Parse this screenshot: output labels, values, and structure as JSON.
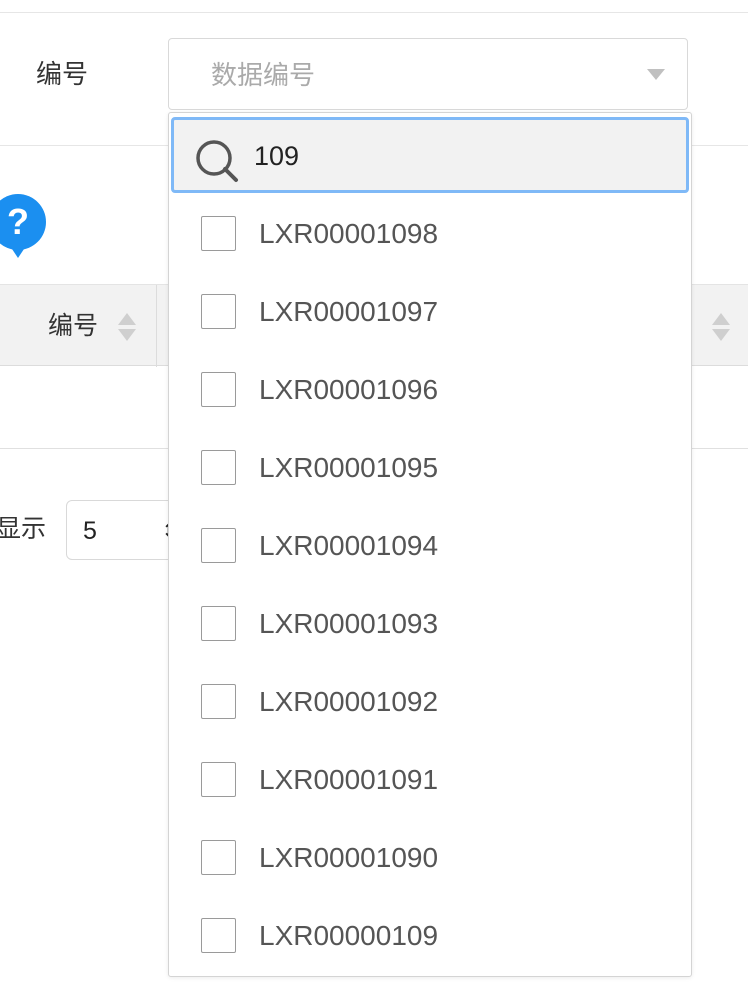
{
  "form": {
    "code_label": "编号",
    "select_placeholder": "数据编号"
  },
  "table": {
    "header_code": "编号"
  },
  "pagination": {
    "show_label": "显示",
    "page_size": "5"
  },
  "dropdown": {
    "search_value": "109",
    "options": [
      {
        "label": "LXR00001098",
        "checked": false
      },
      {
        "label": "LXR00001097",
        "checked": false
      },
      {
        "label": "LXR00001096",
        "checked": false
      },
      {
        "label": "LXR00001095",
        "checked": false
      },
      {
        "label": "LXR00001094",
        "checked": false
      },
      {
        "label": "LXR00001093",
        "checked": false
      },
      {
        "label": "LXR00001092",
        "checked": false
      },
      {
        "label": "LXR00001091",
        "checked": false
      },
      {
        "label": "LXR00001090",
        "checked": false
      },
      {
        "label": "LXR00000109",
        "checked": false
      }
    ]
  },
  "colors": {
    "accent": "#1b8ff0",
    "focus_border": "#7fb9f7",
    "header_bg": "#f2f2f2"
  },
  "icons": [
    "search-icon",
    "help-icon",
    "sort-icon",
    "chevron-down-icon"
  ]
}
